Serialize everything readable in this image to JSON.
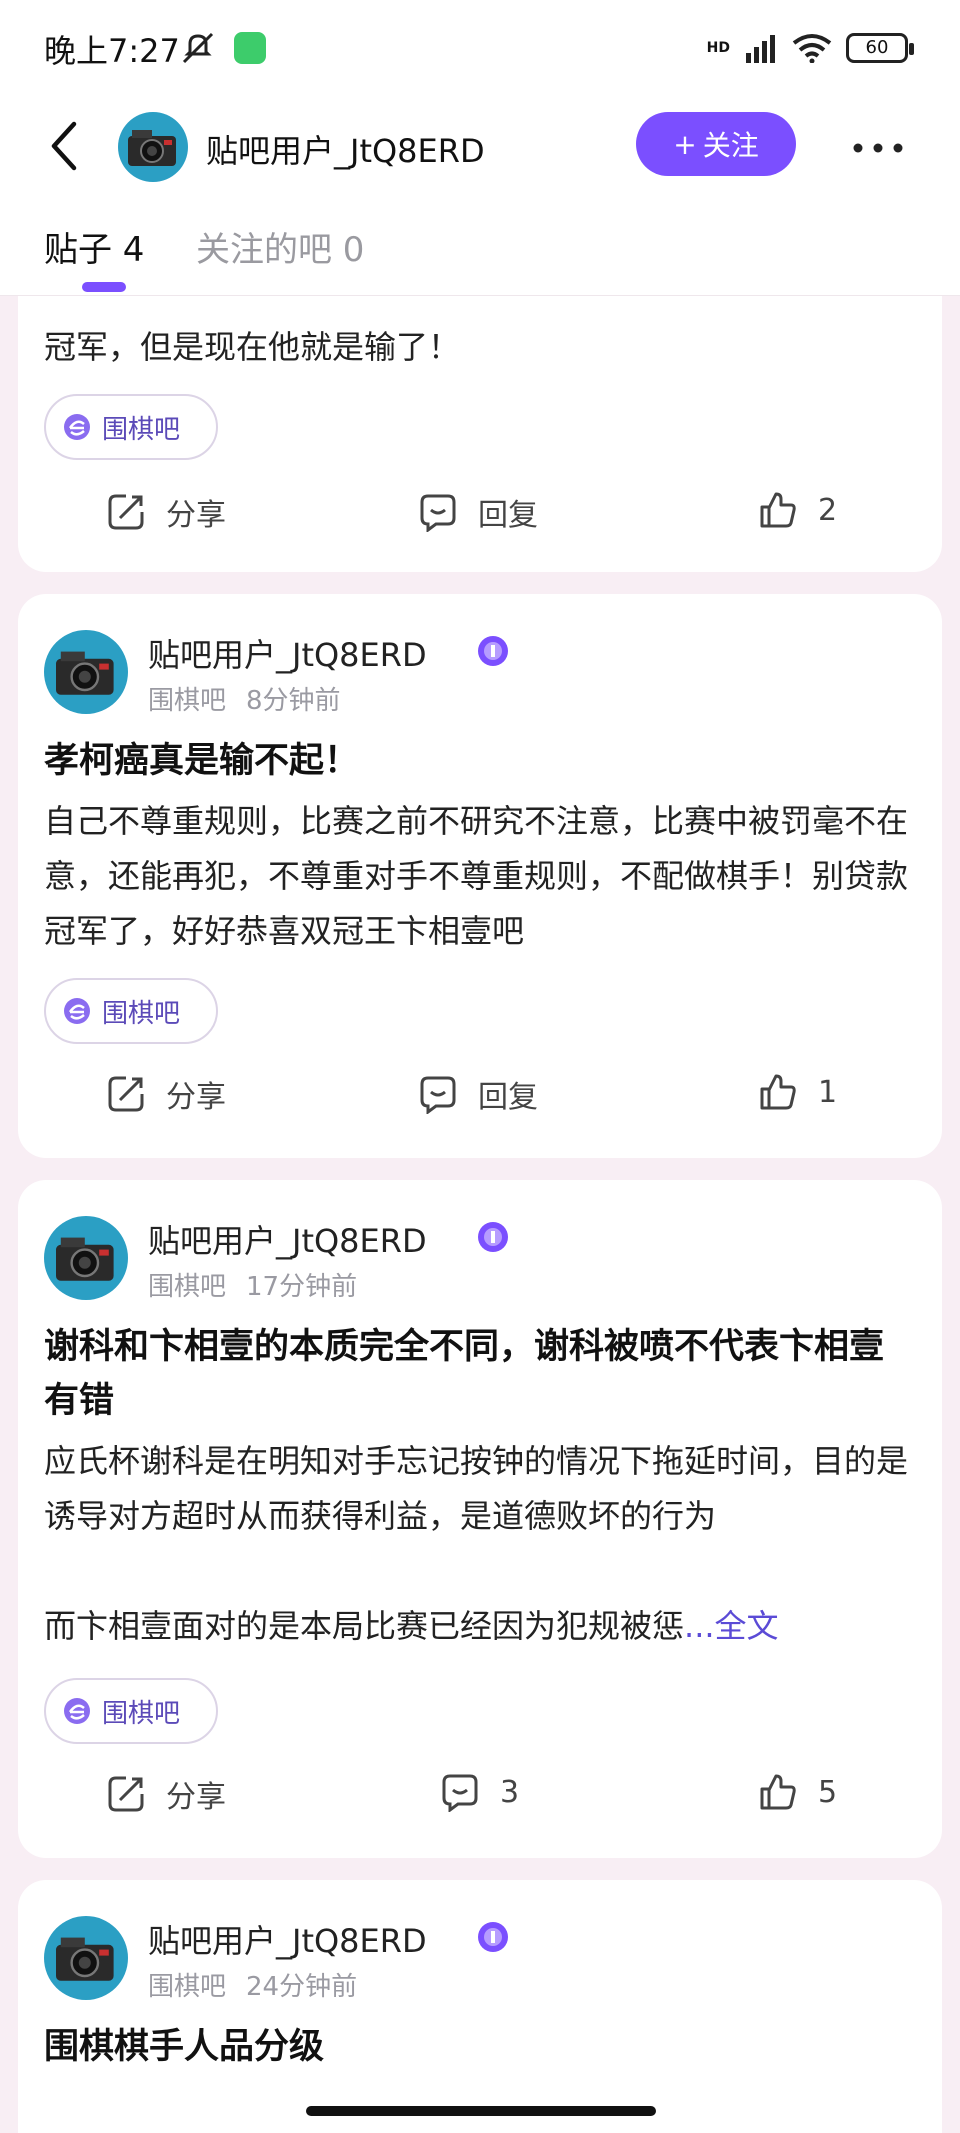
{
  "status": {
    "time": "晚上7:27",
    "network": "HD",
    "battery": "60"
  },
  "header": {
    "username": "贴吧用户_JtQ8ERD",
    "follow_label": "关注",
    "follow_plus": "+",
    "tabs": [
      {
        "label": "贴子 4",
        "active": true
      },
      {
        "label": "关注的吧 0",
        "active": false
      }
    ]
  },
  "colors": {
    "accent": "#7b4fff",
    "chip_text": "#5b4ab8",
    "link": "#5b4bd6"
  },
  "posts": [
    {
      "body_fragment": "冠军，但是现在他就是输了！",
      "forum_chip": "围棋吧",
      "share_label": "分享",
      "reply_label": "回复",
      "likes": "2"
    },
    {
      "author": "贴吧用户_JtQ8ERD",
      "forum": "围棋吧",
      "time": "8分钟前",
      "title": "孝柯癌真是输不起！",
      "body": "自己不尊重规则，比赛之前不研究不注意，比赛中被罚毫不在意，还能再犯，不尊重对手不尊重规则，不配做棋手！别贷款冠军了，好好恭喜双冠王卞相壹吧",
      "forum_chip": "围棋吧",
      "share_label": "分享",
      "reply_label": "回复",
      "likes": "1"
    },
    {
      "author": "贴吧用户_JtQ8ERD",
      "forum": "围棋吧",
      "time": "17分钟前",
      "title": "谢科和卞相壹的本质完全不同，谢科被喷不代表卞相壹有错",
      "body": "应氏杯谢科是在明知对手忘记按钟的情况下拖延时间，目的是诱导对方超时从而获得利益，是道德败坏的行为",
      "body_line_2": "而卞相壹面对的是本局比赛已经因为犯规被惩",
      "more_label": "...全文",
      "forum_chip": "围棋吧",
      "share_label": "分享",
      "replies": "3",
      "likes": "5"
    },
    {
      "author": "贴吧用户_JtQ8ERD",
      "forum": "围棋吧",
      "time": "24分钟前",
      "title": "围棋棋手人品分级"
    }
  ]
}
